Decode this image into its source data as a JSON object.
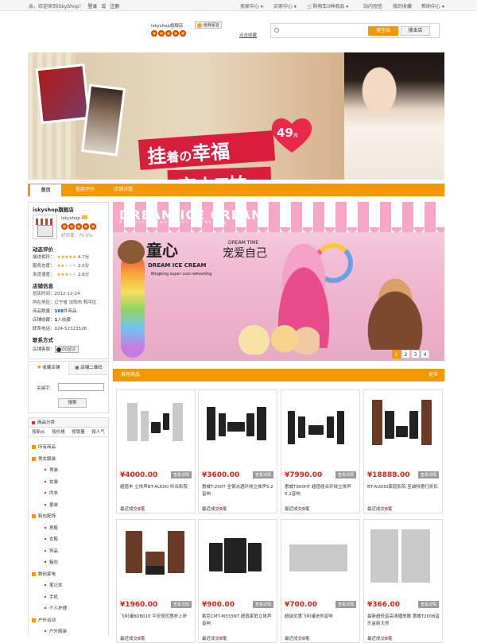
{
  "topbar": {
    "welcome": "亲，欢迎来到iSkyShop！",
    "login": "登录",
    "or": "或",
    "register": "注册",
    "nav": [
      "卖家中心",
      "买家中心",
      "购物车0种商品",
      "站内短信",
      "我的收藏",
      "帮助中心"
    ]
  },
  "shop_header": {
    "shop_name": "iskyshop旗舰店",
    "message_btn": "给我留言",
    "collect": "点击收藏",
    "search_placeholder": "",
    "search_all": "搜全站",
    "search_shop": "搜本店"
  },
  "banner": {
    "headline_1a": "挂",
    "headline_1b": "着の",
    "headline_1c": "幸福",
    "headline_2": "恋上T恤",
    "price": "49",
    "price_unit": "元"
  },
  "nav_tabs": [
    "首页",
    "信用评价",
    "店铺详情"
  ],
  "sidebar": {
    "store_title": "iskyshop旗舰店",
    "seller": "iskyshop",
    "rating_label": "好评率：",
    "rating": "70.0%",
    "dynamic_title": "动态评价",
    "scores": [
      {
        "label": "描述相符：",
        "value": "4.7分"
      },
      {
        "label": "服务态度：",
        "value": "2.0分"
      },
      {
        "label": "发货速度：",
        "value": "2.8分"
      }
    ],
    "info_title": "店铺信息",
    "info": {
      "created_label": "创店时间：",
      "created": "2012-12-24",
      "area_label": "所在地区：",
      "area": "辽宁省 沈阳市 和平区",
      "goods_label": "商品数量：",
      "goods_count": "168",
      "goods_unit": "件商品",
      "collect_label": "店铺收藏：",
      "collect_count": "1",
      "collect_unit": "人收藏",
      "phone_label": "联系电话：",
      "phone": "024-52323528"
    },
    "contact_title": "联系方式",
    "contact_label": "店铺客服：",
    "qq_btn": "QQ留言",
    "subtabs": [
      "收藏店铺",
      "店铺二维码"
    ],
    "keyword_label": "关键字：",
    "keyword_value": "",
    "search_btn": "搜索",
    "category_title": "商品分类",
    "sort": [
      "按新从",
      "按价格",
      "按销量",
      "按人气"
    ],
    "categories": [
      {
        "label": "所有商品",
        "level": 1
      },
      {
        "label": "男女服装",
        "level": 1
      },
      {
        "label": "男装",
        "level": 2
      },
      {
        "label": "女装",
        "level": 2
      },
      {
        "label": "内衣",
        "level": 2
      },
      {
        "label": "童装",
        "level": 2
      },
      {
        "label": "鞋包配饰",
        "level": 1
      },
      {
        "label": "男鞋",
        "level": 2
      },
      {
        "label": "女鞋",
        "level": 2
      },
      {
        "label": "饰品",
        "level": 2
      },
      {
        "label": "箱包",
        "level": 2
      },
      {
        "label": "数码家电",
        "level": 1
      },
      {
        "label": "笔记本",
        "level": 2
      },
      {
        "label": "手机",
        "level": 2
      },
      {
        "label": "个人护理",
        "level": 2
      },
      {
        "label": "户外运动",
        "level": 1
      },
      {
        "label": "户外服装",
        "level": 2
      }
    ]
  },
  "slideshow": {
    "dream_time": "DREAM TIME",
    "logo_a": "童心",
    "logo_b": "宠爱自己",
    "dream_ice": "DREAM ICE CREAM",
    "tagline": "Bingbing super cool refreshing",
    "awning_a": "DREAM",
    "awning_b": "ICE CREAM",
    "awning_sub": "Bingbing super cool refreshing",
    "pages": [
      "1",
      "2",
      "3",
      "4"
    ],
    "active_page": "1"
  },
  "recommend": {
    "title": "推荐商品",
    "more": "更多"
  },
  "products": [
    {
      "price": "¥4000.00",
      "view": "查看详情",
      "desc": "超值丰 立体声BT-AUDIO 听众影院",
      "sold_label": "最近成交",
      "sold": "0",
      "sold_unit": "笔"
    },
    {
      "price": "¥3600.00",
      "view": "查看详情",
      "desc": "惠威T-200T 全钢冰透环绕立体声5.2音响",
      "sold_label": "最近成交",
      "sold": "0",
      "sold_unit": "笔"
    },
    {
      "price": "¥7990.00",
      "view": "查看详情",
      "desc": "惠威T900HT 超值组合环绕立体声5.2音响",
      "sold_label": "最近成交",
      "sold": "0",
      "sold_unit": "笔"
    },
    {
      "price": "¥18888.00",
      "view": "查看详情",
      "desc": "BT-AUDIO家庭影院 至诚特惠打折扣",
      "sold_label": "最近成交",
      "sold": "0",
      "sold_unit": "笔"
    },
    {
      "price": "¥1960.00",
      "view": "查看详情",
      "desc": "飞利浦BD8010 平安夜优惠折上折",
      "sold_label": "最近成交",
      "sold": "0",
      "sold_unit": "笔"
    },
    {
      "price": "¥900.00",
      "view": "查看详情",
      "desc": "索尼CMT-M333NT 超值家庭立体声音响",
      "sold_label": "最近成交",
      "sold": "0",
      "sold_unit": "笔"
    },
    {
      "price": "¥700.00",
      "view": "查看详情",
      "desc": "超级优惠飞利浦迷你音响",
      "sold_label": "最近成交",
      "sold": "0",
      "sold_unit": "笔"
    },
    {
      "price": "¥366.00",
      "view": "查看详情",
      "desc": "最新超低音高清播放器 惠威T200B音乐盒新大师",
      "sold_label": "最近成交",
      "sold": "0",
      "sold_unit": "笔"
    }
  ]
}
